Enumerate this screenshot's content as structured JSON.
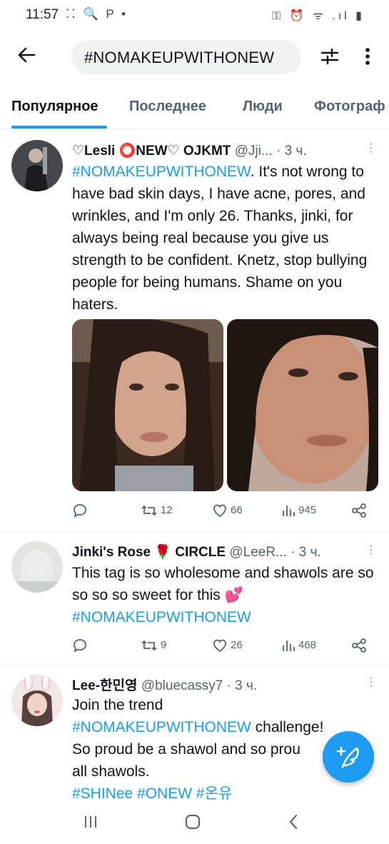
{
  "status_bar": {
    "time": "11:57",
    "left_icons": "⁚⁚ 🔍 P •",
    "right_icons": "⚿ ⏰ ᯤ .ıl ▮"
  },
  "header": {
    "search_value": "#NOMAKEUPWITHONEW"
  },
  "tabs": [
    "Популярное",
    "Последнее",
    "Люди",
    "Фотограф"
  ],
  "tweets": [
    {
      "name": "♡Lesli ⭕NEW♡ OJKMT",
      "handle": "@Jji...",
      "time": "· 3 ч.",
      "text_tag": "#NOMAKEUPWITHONEW",
      "text": ". It's not wrong to have bad skin days, I have acne, pores, and wrinkles, and I'm only 26. Thanks, jinki, for always being real because you give us strength to be confident. Knetz, stop bullying people for being humans. Shame on you haters.",
      "retweets": "12",
      "likes": "66",
      "views": "945"
    },
    {
      "name": "Jinki's Rose 🌹 CIRCLE",
      "handle": "@LeeR...",
      "time": "· 3 ч.",
      "text": "This tag is so wholesome and shawols are so so so so sweet for this 💕",
      "text_tag": "#NOMAKEUPWITHONEW",
      "retweets": "9",
      "likes": "26",
      "views": "468"
    },
    {
      "name": "Lee-한민영",
      "handle": "@bluecassy7",
      "time": "· 3 ч.",
      "line1": "Join the trend",
      "text_tag": "#NOMAKEUPWITHONEW",
      "line2_rest": " challenge!",
      "line3": "So proud be a shawol and so prou",
      "line4": "all shawols.",
      "tags_line": "#SHINee #ONEW #온유"
    }
  ]
}
